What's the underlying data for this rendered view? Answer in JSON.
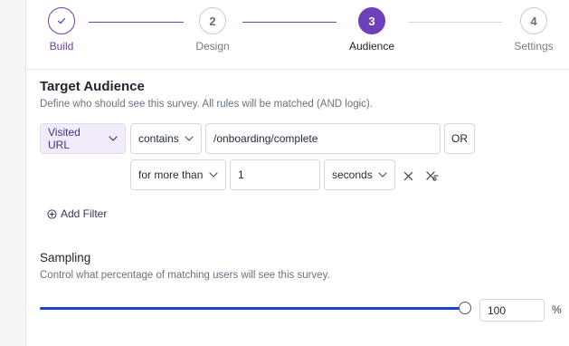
{
  "stepper": {
    "steps": [
      {
        "number": "✓",
        "label": "Build",
        "state": "done"
      },
      {
        "number": "2",
        "label": "Design",
        "state": "pending"
      },
      {
        "number": "3",
        "label": "Audience",
        "state": "active"
      },
      {
        "number": "4",
        "label": "Settings",
        "state": "pending"
      }
    ],
    "accent": "#6d3fb8"
  },
  "target_audience": {
    "title": "Target Audience",
    "description": "Define who should see this survey. All rules will be matched (AND logic).",
    "rule1": {
      "attribute": "Visited URL",
      "operator": "contains",
      "value": "/onboarding/complete",
      "or_label": "OR"
    },
    "rule2": {
      "duration_operator": "for more than",
      "duration_value": "1",
      "duration_unit": "seconds"
    },
    "add_filter_label": "Add Filter"
  },
  "sampling": {
    "title": "Sampling",
    "description": "Control what percentage of matching users will see this survey.",
    "value": "100",
    "percent_fraction": 1.0,
    "unit": "%",
    "accent": "#1d3fd6"
  }
}
